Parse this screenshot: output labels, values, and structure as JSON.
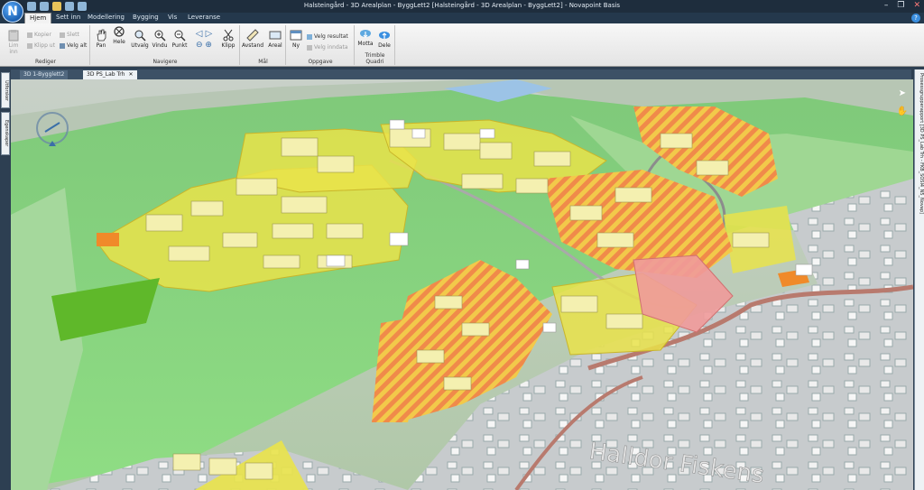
{
  "window": {
    "title": "Halsteingård - 3D Arealplan - ByggLett2 [Halsteingård - 3D Arealplan - ByggLett2] - Novapoint Basis",
    "logo_letter": "N"
  },
  "ribbon_tabs": [
    "Hjem",
    "Sett inn",
    "Modellering",
    "Bygging",
    "Vis",
    "Leveranse"
  ],
  "ribbon": {
    "rediger": {
      "label": "Rediger",
      "lim_inn": "Lim inn",
      "kopier": "Kopier",
      "klipp_ut": "Klipp ut",
      "slett": "Slett",
      "velg_alt": "Velg alt"
    },
    "navigere": {
      "label": "Navigere",
      "pan": "Pan",
      "hele": "Hele",
      "utvalg": "Utvalg",
      "vindu": "Vindu",
      "punkt": "Punkt",
      "klipp": "Klipp"
    },
    "maal": {
      "label": "Mål",
      "avstand": "Avstand",
      "areal": "Areal"
    },
    "oppgave": {
      "label": "Oppgave",
      "ny": "Ny",
      "velg_resultat": "Velg resultat",
      "velg_inndata": "Velg inndata"
    },
    "trimble": {
      "label": "Trimble Quadri",
      "motta": "Motta",
      "dele": "Dele"
    }
  },
  "doc_tabs": [
    {
      "label": "3D 1-Bygglett2",
      "active": false
    },
    {
      "label": "3D PS_Lab Trh",
      "active": true
    }
  ],
  "side_panels": {
    "left_1": "Utforsker",
    "left_2": "Egenskaper",
    "right": "Prosessgrupperapport [3D PS_Lab Trh - FKB_SOSI4_N5_Novap]"
  },
  "viewport": {
    "road_label": "Halldor Fiskens",
    "colors": {
      "terrain_green": "#7ed27a",
      "terrain_light": "#a7e29d",
      "urban_grey": "#cfd3d5",
      "plan_yellow": "#e6e24a",
      "hatched_orange": "#f08a2a",
      "pink_zone": "#f09a9a",
      "road_brown": "#c9887a"
    }
  }
}
